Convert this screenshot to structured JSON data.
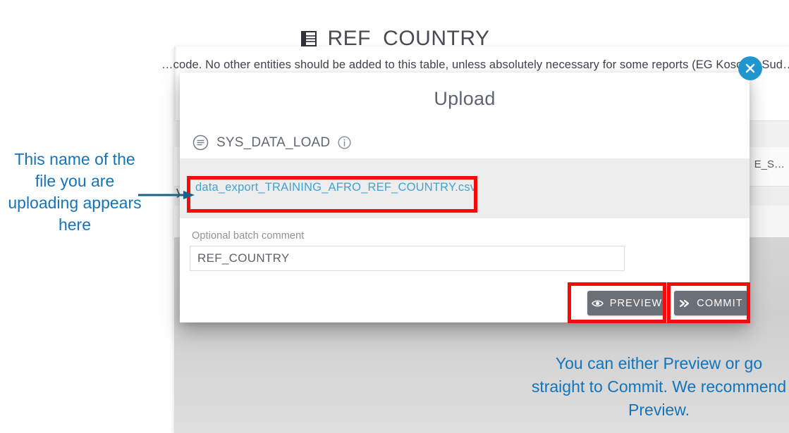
{
  "background": {
    "page_title": "REF_COUNTRY",
    "page_title_icon": "table-icon",
    "description": "…code. No other entities should be added to this table, unless absolutely necessary for some reports (EG Kosovo, Sud…",
    "clipped_left_char": "y",
    "column_header_partial": "E_S…"
  },
  "close_button": {
    "label": "×",
    "icon": "close-icon",
    "color": "#2196ce"
  },
  "dialog": {
    "title": "Upload",
    "loader": {
      "icon": "list-circle-icon",
      "name": "SYS_DATA_LOAD",
      "info_icon": "info-circle-icon"
    },
    "file": {
      "name": "data_export_TRAINING_AFRO_REF_COUNTRY.csv",
      "link_color": "#41a3d1"
    },
    "comment": {
      "label": "Optional batch comment",
      "value": "REF_COUNTRY",
      "placeholder": "Optional batch comment"
    },
    "actions": {
      "preview_label": "PREVIEW",
      "preview_icon": "eye-icon",
      "commit_label": "COMMIT",
      "commit_icon": "double-chevron-right-icon"
    }
  },
  "annotations": {
    "highlight_color": "#f60a0a",
    "text_color": "#1374ba",
    "left_note": "This name of the file you are uploading appears here",
    "right_note": "You can either Preview or go straight to Commit. We recommend Preview.",
    "arrow_icon": "arrow-right-icon"
  }
}
